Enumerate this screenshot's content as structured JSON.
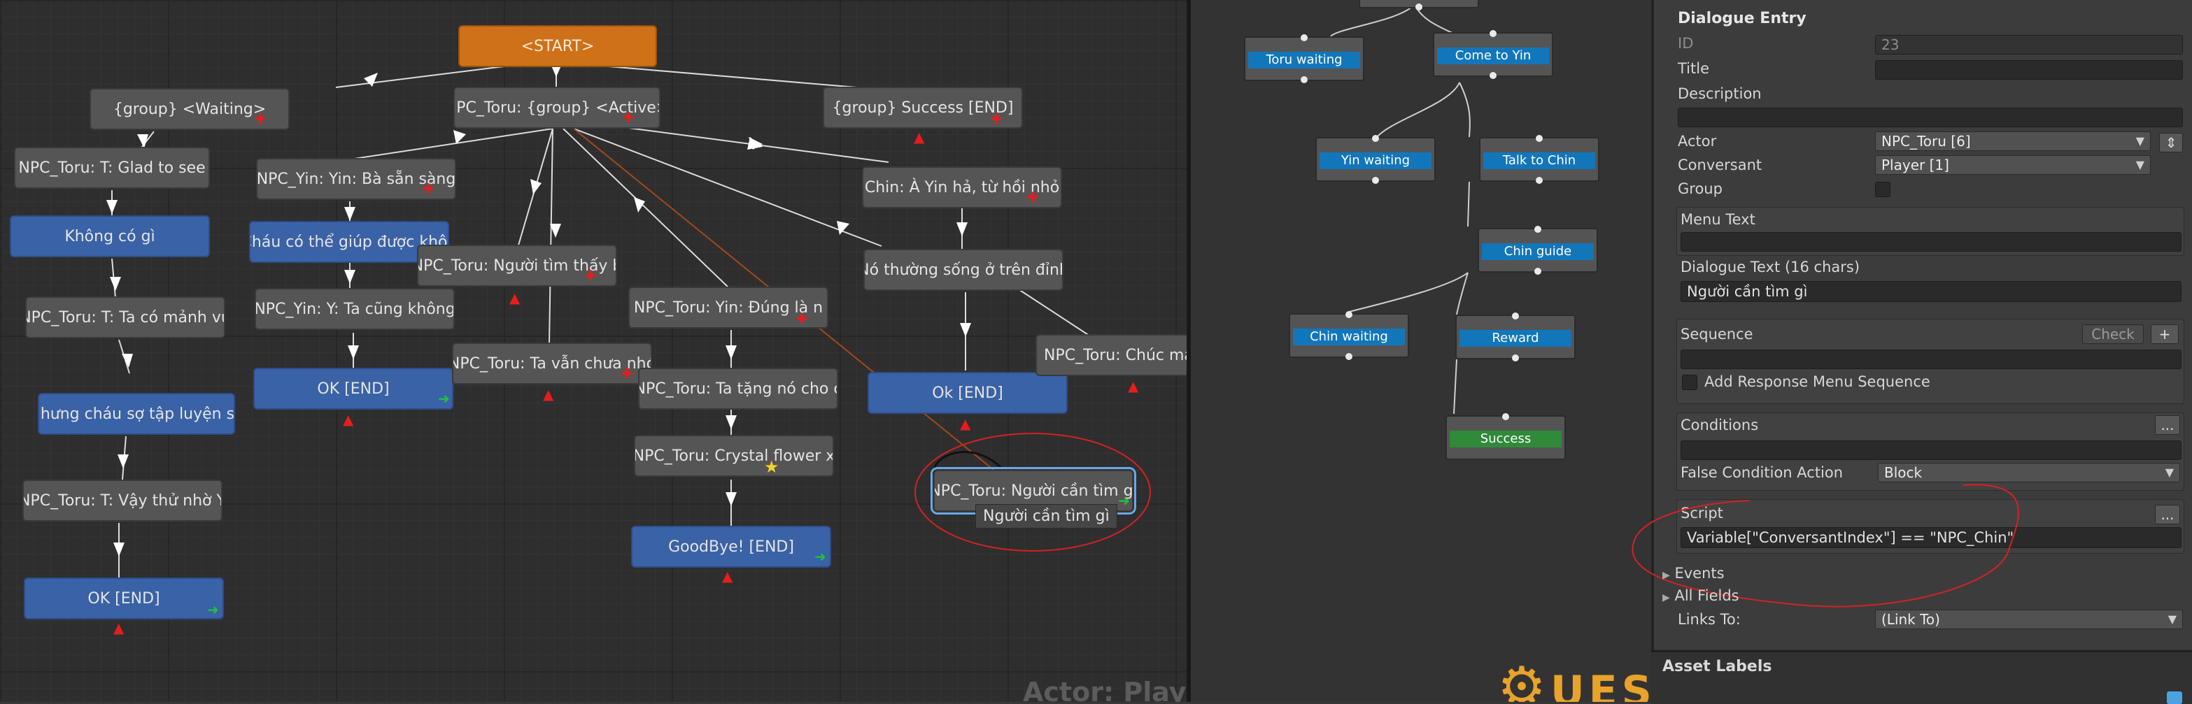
{
  "graph": {
    "nodes": {
      "start": "<START>",
      "group_waiting": "{group} <Waiting>",
      "group_active": "NPC_Toru: {group} <Active>",
      "group_success": "{group} Success [END]",
      "toru_glad": "NPC_Toru:  T: Glad to see",
      "khong_co_gi": "Không có gì",
      "toru_ta_co": "NPC_Toru: T: Ta có mảnh vư",
      "nhung_chau": "Nhưng cháu sợ tập luyện sẽ",
      "toru_vay_thu": "NPC_Toru: T: Vậy thử nhờ Y",
      "ok_end_left": "OK  [END]",
      "yin_ba_san_sang": "NPC_Yin: Yin: Bà sẵn sàng",
      "chau_co_the": "Cháu có thể giúp được khôn",
      "yin_ta_cung": "NPC_Yin: Y: Ta cũng không",
      "ok_end_mid": "OK [END]",
      "toru_nguoi_tim_thay": "NPC_Toru: Người tìm thấy b",
      "toru_ta_van_chua": "NPC_Toru: Ta vẫn chưa nhớ",
      "toru_yin_dung_la": "NPC_Toru:   Yin: Đúng là n",
      "toru_ta_tang": "NPC_Toru: Ta tặng nó cho c",
      "toru_crystal": "NPC_Toru: Crystal flower x",
      "goodbye_end": "GoodBye! [END]",
      "chin_a_yin": "Chin: À Yin hả, từ hồi nhỏ",
      "no_thuong_song": "Nó thường sống ở trên đỉnh",
      "ok_end_right": "Ok [END]",
      "toru_chuc_may": "NPC_Toru: Chúc may mắ",
      "toru_nguoi_can_tim": "NPC_Toru: Người cần tìm gì"
    },
    "tooltip": "Người cần tìm gì",
    "watermark": "Actor: Player"
  },
  "tree": {
    "nodes": {
      "toru_waiting": "Toru waiting",
      "come_to_yin": "Come to Yin",
      "yin_waiting": "Yin waiting",
      "talk_to_chin": "Talk to Chin",
      "chin_guide": "Chin guide",
      "chin_waiting": "Chin waiting",
      "reward": "Reward",
      "success": "Success"
    },
    "logo_text": "UEST"
  },
  "inspector": {
    "header": "Dialogue Entry",
    "id_label": "ID",
    "id_value": "23",
    "title_label": "Title",
    "title_value": "",
    "description_label": "Description",
    "description_value": "",
    "actor_label": "Actor",
    "actor_value": "NPC_Toru [6]",
    "conversant_label": "Conversant",
    "conversant_value": "Player [1]",
    "group_label": "Group",
    "menu_text_label": "Menu Text",
    "menu_text_value": "",
    "dialogue_text_label": "Dialogue Text (16 chars)",
    "dialogue_text_value": "Người cần tìm gì",
    "sequence_label": "Sequence",
    "check_label": "Check",
    "plus_label": "+",
    "sequence_value": "",
    "add_response_label": "Add Response Menu Sequence",
    "conditions_label": "Conditions",
    "ellipsis_label": "...",
    "conditions_value": "",
    "false_condition_label": "False Condition Action",
    "false_condition_value": "Block",
    "script_label": "Script",
    "script_value": "Variable[\"ConversantIndex\"] == \"NPC_Chin\"",
    "events_label": "Events",
    "all_fields_label": "All Fields",
    "links_to_label": "Links To:",
    "links_to_value": "(Link To)",
    "asset_labels": "Asset Labels"
  },
  "colors": {
    "start_node": "#cf7118",
    "end_node": "#3a62a6",
    "tree_bar": "#1276ba",
    "success_bar": "#2f8a3a",
    "annotation": "#e02525"
  }
}
